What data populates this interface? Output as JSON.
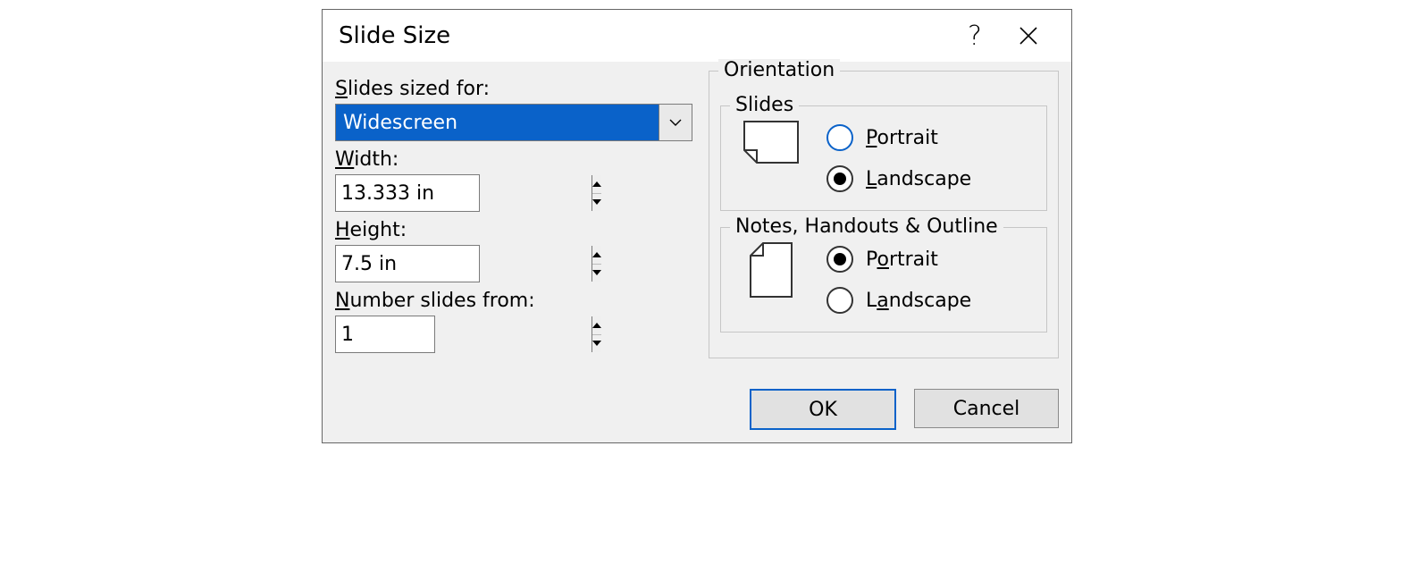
{
  "title": "Slide Size",
  "left": {
    "sized_for_label": "lides sized for:",
    "sized_for_accel": "S",
    "sized_for_value": "Widescreen",
    "width_label": "idth:",
    "width_accel": "W",
    "width_value": "13.333 in",
    "height_label": "eight:",
    "height_accel": "H",
    "height_value": "7.5 in",
    "number_label": "umber slides from:",
    "number_accel": "N",
    "number_value": "1"
  },
  "orientation": {
    "group_label": "Orientation",
    "slides": {
      "group_label": "Slides",
      "portrait_label": "ortrait",
      "portrait_accel": "P",
      "landscape_label": "andscape",
      "landscape_accel": "L",
      "selected": "Landscape"
    },
    "notes": {
      "group_label": "Notes, Handouts & Outline",
      "portrait_label": "rtrait",
      "portrait_prefix": "P",
      "portrait_accel": "o",
      "landscape_label": "ndscape",
      "landscape_prefix": "L",
      "landscape_accel": "a",
      "selected": "Portrait"
    }
  },
  "buttons": {
    "ok": "OK",
    "cancel": "Cancel"
  }
}
